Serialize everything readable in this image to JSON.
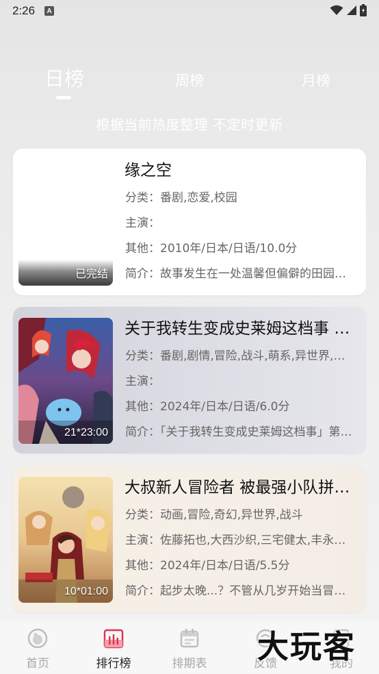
{
  "status_bar": {
    "time": "2:26",
    "notif_letter": "A",
    "icons": [
      "wifi-icon",
      "signal-icon",
      "battery-icon"
    ]
  },
  "tabs": {
    "items": [
      {
        "label": "日榜",
        "active": true
      },
      {
        "label": "周榜",
        "active": false
      },
      {
        "label": "月榜",
        "active": false
      }
    ]
  },
  "subtitle": "根据当前热度整理 不定时更新",
  "cards": [
    {
      "title": "缘之空",
      "category": "分类：番剧,恋爱,校园",
      "cast": "主演：",
      "other": "其他：2010年/日本/日语/10.0分",
      "intro": "简介：故事发生在一处温馨但偏僻的田园小镇…",
      "badge": "已完结"
    },
    {
      "title": "关于我转生变成史莱姆这档事 第三季",
      "category": "分类：番剧,剧情,冒险,战斗,萌系,异世界,奇幻",
      "cast": "主演：",
      "other": "其他：2024年/日本/日语/6.0分",
      "intro": "简介：「关于我转生变成史莱姆这档事」第三季…",
      "badge": "21*23:00"
    },
    {
      "title": "大叔新人冒险者 被最强小队拼死锻炼后无敌了",
      "category": "分类：动画,冒险,奇幻,异世界,战斗",
      "cast": "主演：佐藤拓也,大西沙织,三宅健太,丰永利行",
      "other": "其他：2024年/日本/日语/5.5分",
      "intro": "简介：起步太晚...？不管从几岁开始当冒险者…",
      "badge": "10*01:00"
    }
  ],
  "bottom_nav": {
    "items": [
      {
        "label": "首页",
        "icon": "home-icon",
        "active": false
      },
      {
        "label": "排行榜",
        "icon": "ranking-icon",
        "active": true
      },
      {
        "label": "排期表",
        "icon": "calendar-icon",
        "active": false
      },
      {
        "label": "反馈",
        "icon": "feedback-icon",
        "active": false
      },
      {
        "label": "我的",
        "icon": "profile-icon",
        "active": false
      }
    ]
  },
  "watermark": "大玩客",
  "colors": {
    "accent": "#e0334d",
    "tab_text": "#ffffff",
    "nav_inactive": "#a8a8a8",
    "nav_active": "#222222"
  }
}
